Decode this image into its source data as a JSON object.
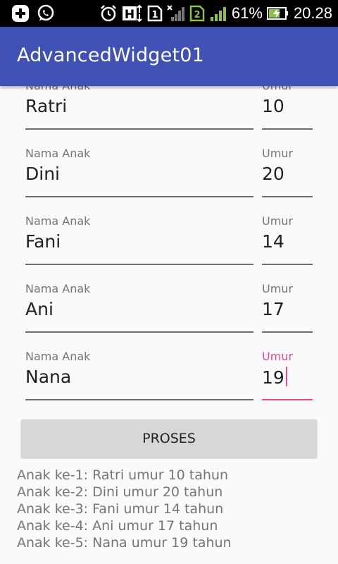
{
  "status_bar": {
    "icons_left": [
      "add-icon",
      "whatsapp-icon"
    ],
    "icons_right": [
      "alarm-icon",
      "hspa-icon",
      "sim1-icon",
      "signal-bars-icon",
      "sim2-icon",
      "signal-bars-green-icon",
      "charging-battery-icon"
    ],
    "battery": "61%",
    "time": "20.28"
  },
  "app_bar": {
    "title": "AdvancedWidget01",
    "color": "#3f51b5"
  },
  "form": {
    "rows": [
      {
        "name_label": "Nama Anak",
        "name_value": "Ratri",
        "age_label": "Umur",
        "age_value": "10"
      },
      {
        "name_label": "Nama Anak",
        "name_value": "Dini",
        "age_label": "Umur",
        "age_value": "20"
      },
      {
        "name_label": "Nama Anak",
        "name_value": "Fani",
        "age_label": "Umur",
        "age_value": "14"
      },
      {
        "name_label": "Nama Anak",
        "name_value": "Ani",
        "age_label": "Umur",
        "age_value": "17"
      },
      {
        "name_label": "Nama Anak",
        "name_value": "Nana",
        "age_label": "Umur",
        "age_value": "19"
      }
    ],
    "accent_color": "#e64a8b"
  },
  "button": {
    "label": "PROSES"
  },
  "results": [
    "Anak ke-1: Ratri umur 10 tahun",
    "Anak ke-2: Dini umur 20 tahun",
    "Anak ke-3: Fani umur 14 tahun",
    "Anak ke-4: Ani umur 17 tahun",
    "Anak ke-5: Nana umur 19 tahun"
  ]
}
